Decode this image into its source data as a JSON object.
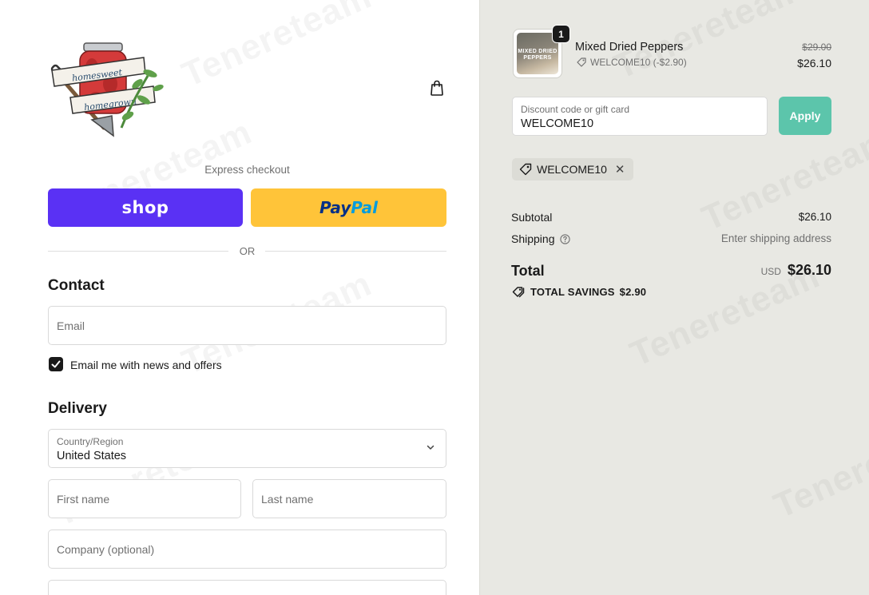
{
  "logo": {
    "banner_top": "homesweet",
    "banner_bottom": "homegrown"
  },
  "express": {
    "label": "Express checkout",
    "shop_label": "shop",
    "paypal_label_1": "Pay",
    "paypal_label_2": "Pal",
    "or_label": "OR"
  },
  "contact": {
    "title": "Contact",
    "email_placeholder": "Email",
    "newsletter_label": "Email me with news and offers",
    "newsletter_checked": true
  },
  "delivery": {
    "title": "Delivery",
    "country_label": "Country/Region",
    "country_value": "United States",
    "first_name_placeholder": "First name",
    "last_name_placeholder": "Last name",
    "company_placeholder": "Company (optional)"
  },
  "cart": {
    "item": {
      "name": "Mixed Dried Peppers",
      "quantity": "1",
      "discount": "WELCOME10 (-$2.90)",
      "old_price": "$29.00",
      "price": "$26.10",
      "thumb_text": "MIXED DRIED PEPPERS"
    }
  },
  "discount": {
    "label": "Discount code or gift card",
    "value": "WELCOME10",
    "apply_label": "Apply",
    "applied_code": "WELCOME10"
  },
  "summary": {
    "subtotal_label": "Subtotal",
    "subtotal_value": "$26.10",
    "shipping_label": "Shipping",
    "shipping_value": "Enter shipping address",
    "total_label": "Total",
    "currency": "USD",
    "total_value": "$26.10",
    "savings_label": "TOTAL SAVINGS",
    "savings_value": "$2.90"
  },
  "colors": {
    "shop_purple": "#5a31f4",
    "paypal_yellow": "#ffc439",
    "apply_teal": "#5cc5ab",
    "summary_bg": "#e8e8e3"
  },
  "icons": [
    "shopping-bag-icon",
    "tag-icon",
    "close-icon",
    "help-circle-icon",
    "chevron-down-icon",
    "checkmark-icon"
  ]
}
